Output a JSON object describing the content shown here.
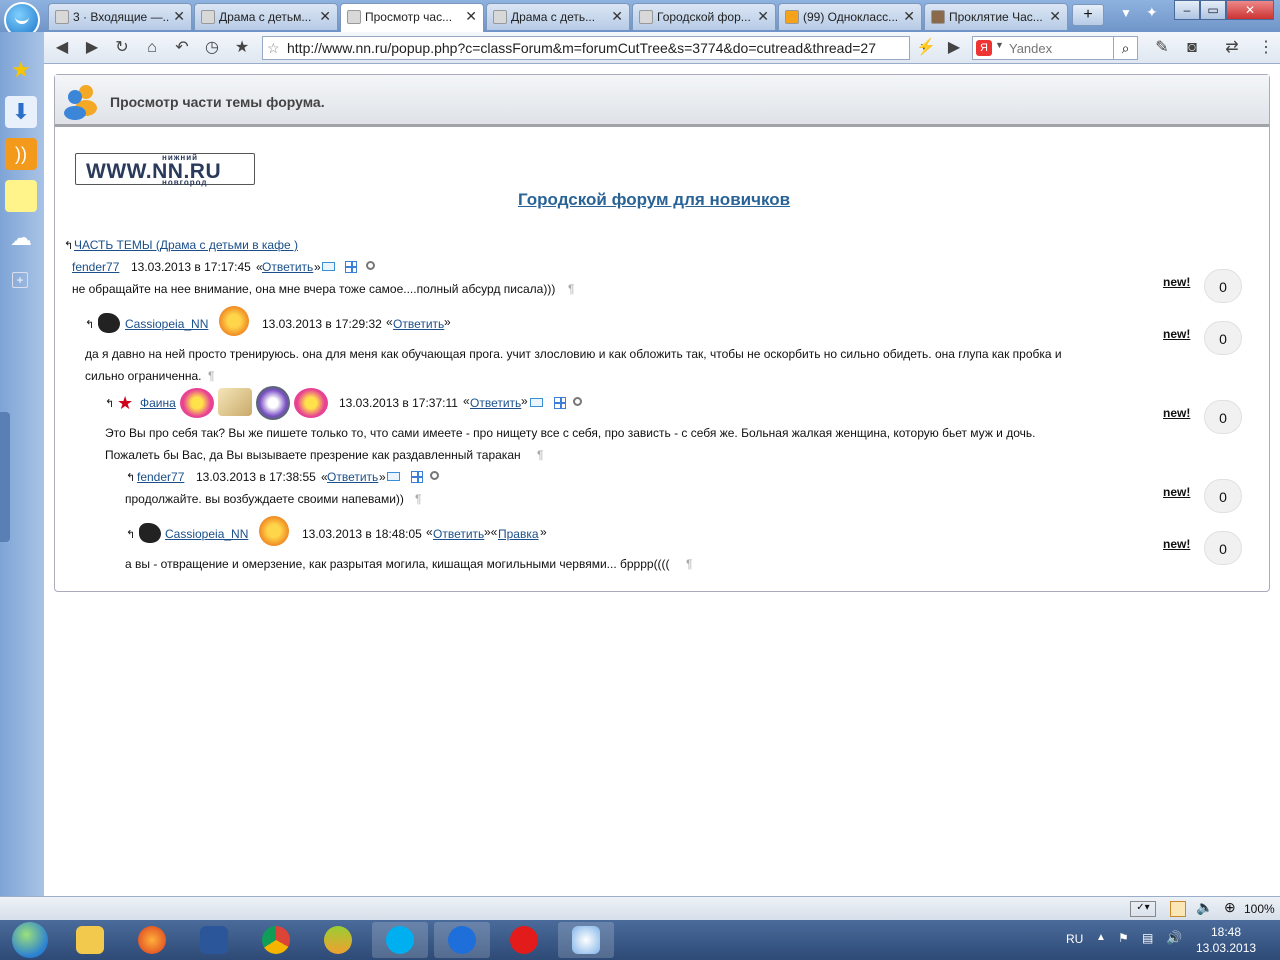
{
  "tabs": [
    {
      "label": "3 · Входящие —..."
    },
    {
      "label": "Драма с детьм..."
    },
    {
      "label": "Просмотр час..."
    },
    {
      "label": "Драма с деть..."
    },
    {
      "label": "Городской фор..."
    },
    {
      "label": "(99) Однокласс..."
    },
    {
      "label": "Проклятие Час..."
    }
  ],
  "tab_close": "✕",
  "new_tab": "+",
  "window": {
    "minimize": "–",
    "maximize": "▭",
    "close": "✕"
  },
  "nav": {
    "url": "http://www.nn.ru/popup.php?c=classForum&m=forumCutTree&s=3774&do=cutread&thread=27",
    "search_placeholder": "Yandex",
    "search_logo": "Я"
  },
  "popup": {
    "title": "Просмотр части темы форума."
  },
  "logo": {
    "main": "WWW.NN.RU",
    "top": "нижний",
    "bottom": "новгород"
  },
  "forum_title": "Городской форум для новичков",
  "thread_link": "ЧАСТЬ ТЕМЫ (Драма с детьми в кафе )",
  "reply_label": "Ответить",
  "edit_label": "Правка",
  "new_label": "new!",
  "pilcrow": "¶",
  "posts": [
    {
      "author": "fender77",
      "date": "13.03.2013 в 17:17:45",
      "text": "не обращайте на нее внимание, она мне вчера тоже самое....полный абсурд писала)))",
      "count": "0"
    },
    {
      "author": "Cassiopeia_NN",
      "date": "13.03.2013 в 17:29:32",
      "text1": "да я давно на ней просто тренируюсь. она для меня как обучающая прога. учит злословию и как обложить так, чтобы не оскорбить но сильно обидеть. она глупа как пробка и",
      "text2": "сильно ограниченна.",
      "count": "0"
    },
    {
      "author": "Фаина",
      "date": "13.03.2013 в 17:37:11",
      "text1": "Это Вы про себя так? Вы же пишете только то, что сами имеете - про нищету все с себя, про зависть - с себя же. Больная жалкая женщина, которую бьет муж и дочь.",
      "text2": "Пожалеть бы Вас, да Вы вызываете презрение как раздавленный таракан",
      "count": "0"
    },
    {
      "author": "fender77",
      "date": "13.03.2013 в 17:38:55",
      "text": "продолжайте. вы возбуждаете своими напевами))",
      "count": "0"
    },
    {
      "author": "Cassiopeia_NN",
      "date": "13.03.2013 в 18:48:05",
      "text": "а вы - отвращение и омерзение, как разрытая могила, кишащая могильными червями... брррр((((",
      "count": "0"
    }
  ],
  "status": {
    "zoom": "100%"
  },
  "tray": {
    "lang": "RU",
    "time": "18:48",
    "date": "13.03.2013"
  },
  "colors": {
    "link": "#1a4f8a",
    "forum_title": "#2a6396",
    "taskbar": "#2e4a76"
  }
}
